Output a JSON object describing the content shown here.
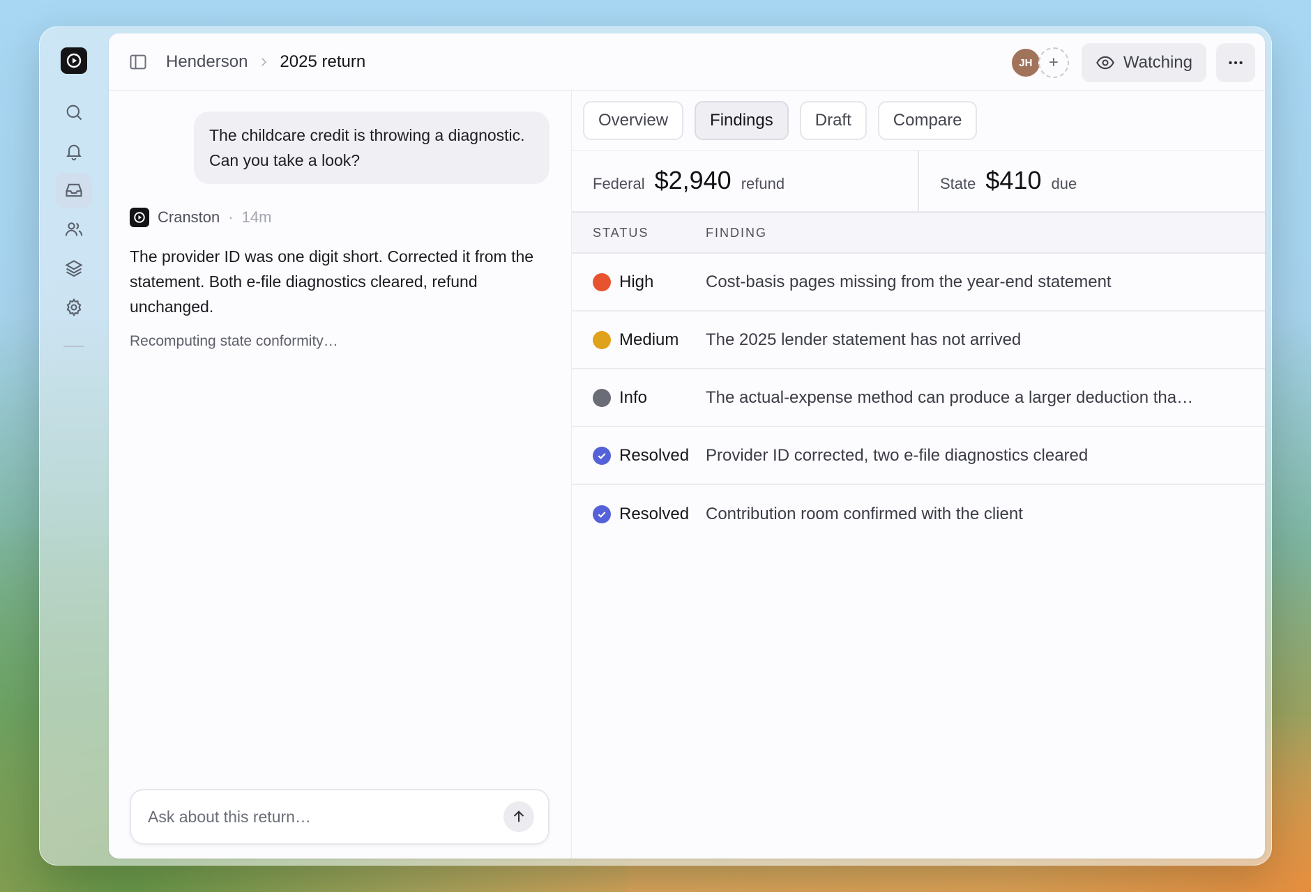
{
  "breadcrumb": {
    "client": "Henderson",
    "item": "2025 return"
  },
  "header": {
    "avatar_initials": "JH",
    "add_label": "+",
    "watch_label": "Watching"
  },
  "rail": {
    "items": [
      {
        "icon": "search-icon"
      },
      {
        "icon": "bell-icon"
      },
      {
        "icon": "inbox-icon",
        "active": true
      },
      {
        "icon": "people-icon"
      },
      {
        "icon": "layers-icon"
      },
      {
        "icon": "gear-icon"
      }
    ]
  },
  "chat": {
    "user_message": "The childcare credit is throwing a diagnostic. Can you take a look?",
    "assistant_name": "Cranston",
    "separator": "·",
    "assistant_time": "14m",
    "assistant_message": "The provider ID was one digit short. Corrected it from the statement. Both e-file diagnostics cleared, refund unchanged.",
    "status": "Recomputing state conformity…",
    "input_placeholder": "Ask about this return…"
  },
  "tabs": [
    {
      "label": "Overview",
      "active": false
    },
    {
      "label": "Findings",
      "active": true
    },
    {
      "label": "Draft",
      "active": false
    },
    {
      "label": "Compare",
      "active": false
    }
  ],
  "totals": {
    "federal": {
      "label": "Federal",
      "amount": "$2,940",
      "kind": "refund"
    },
    "state": {
      "label": "State",
      "amount": "$410",
      "kind": "due"
    }
  },
  "findings": {
    "columns": [
      "STATUS",
      "FINDING"
    ],
    "rows": [
      {
        "status": "High",
        "marker": "dot",
        "color": "#e8532f",
        "finding": "Cost-basis pages missing from the year-end statement"
      },
      {
        "status": "Medium",
        "marker": "dot",
        "color": "#e0a21a",
        "finding": "The 2025 lender statement has not arrived"
      },
      {
        "status": "Info",
        "marker": "dot",
        "color": "#6a6c76",
        "finding": "The actual-expense method can produce a larger deduction tha…"
      },
      {
        "status": "Resolved",
        "marker": "check",
        "color": "#5561d8",
        "finding": "Provider ID corrected, two e-file diagnostics cleared"
      },
      {
        "status": "Resolved",
        "marker": "check",
        "color": "#5561d8",
        "finding": "Contribution room confirmed with the client"
      }
    ]
  }
}
